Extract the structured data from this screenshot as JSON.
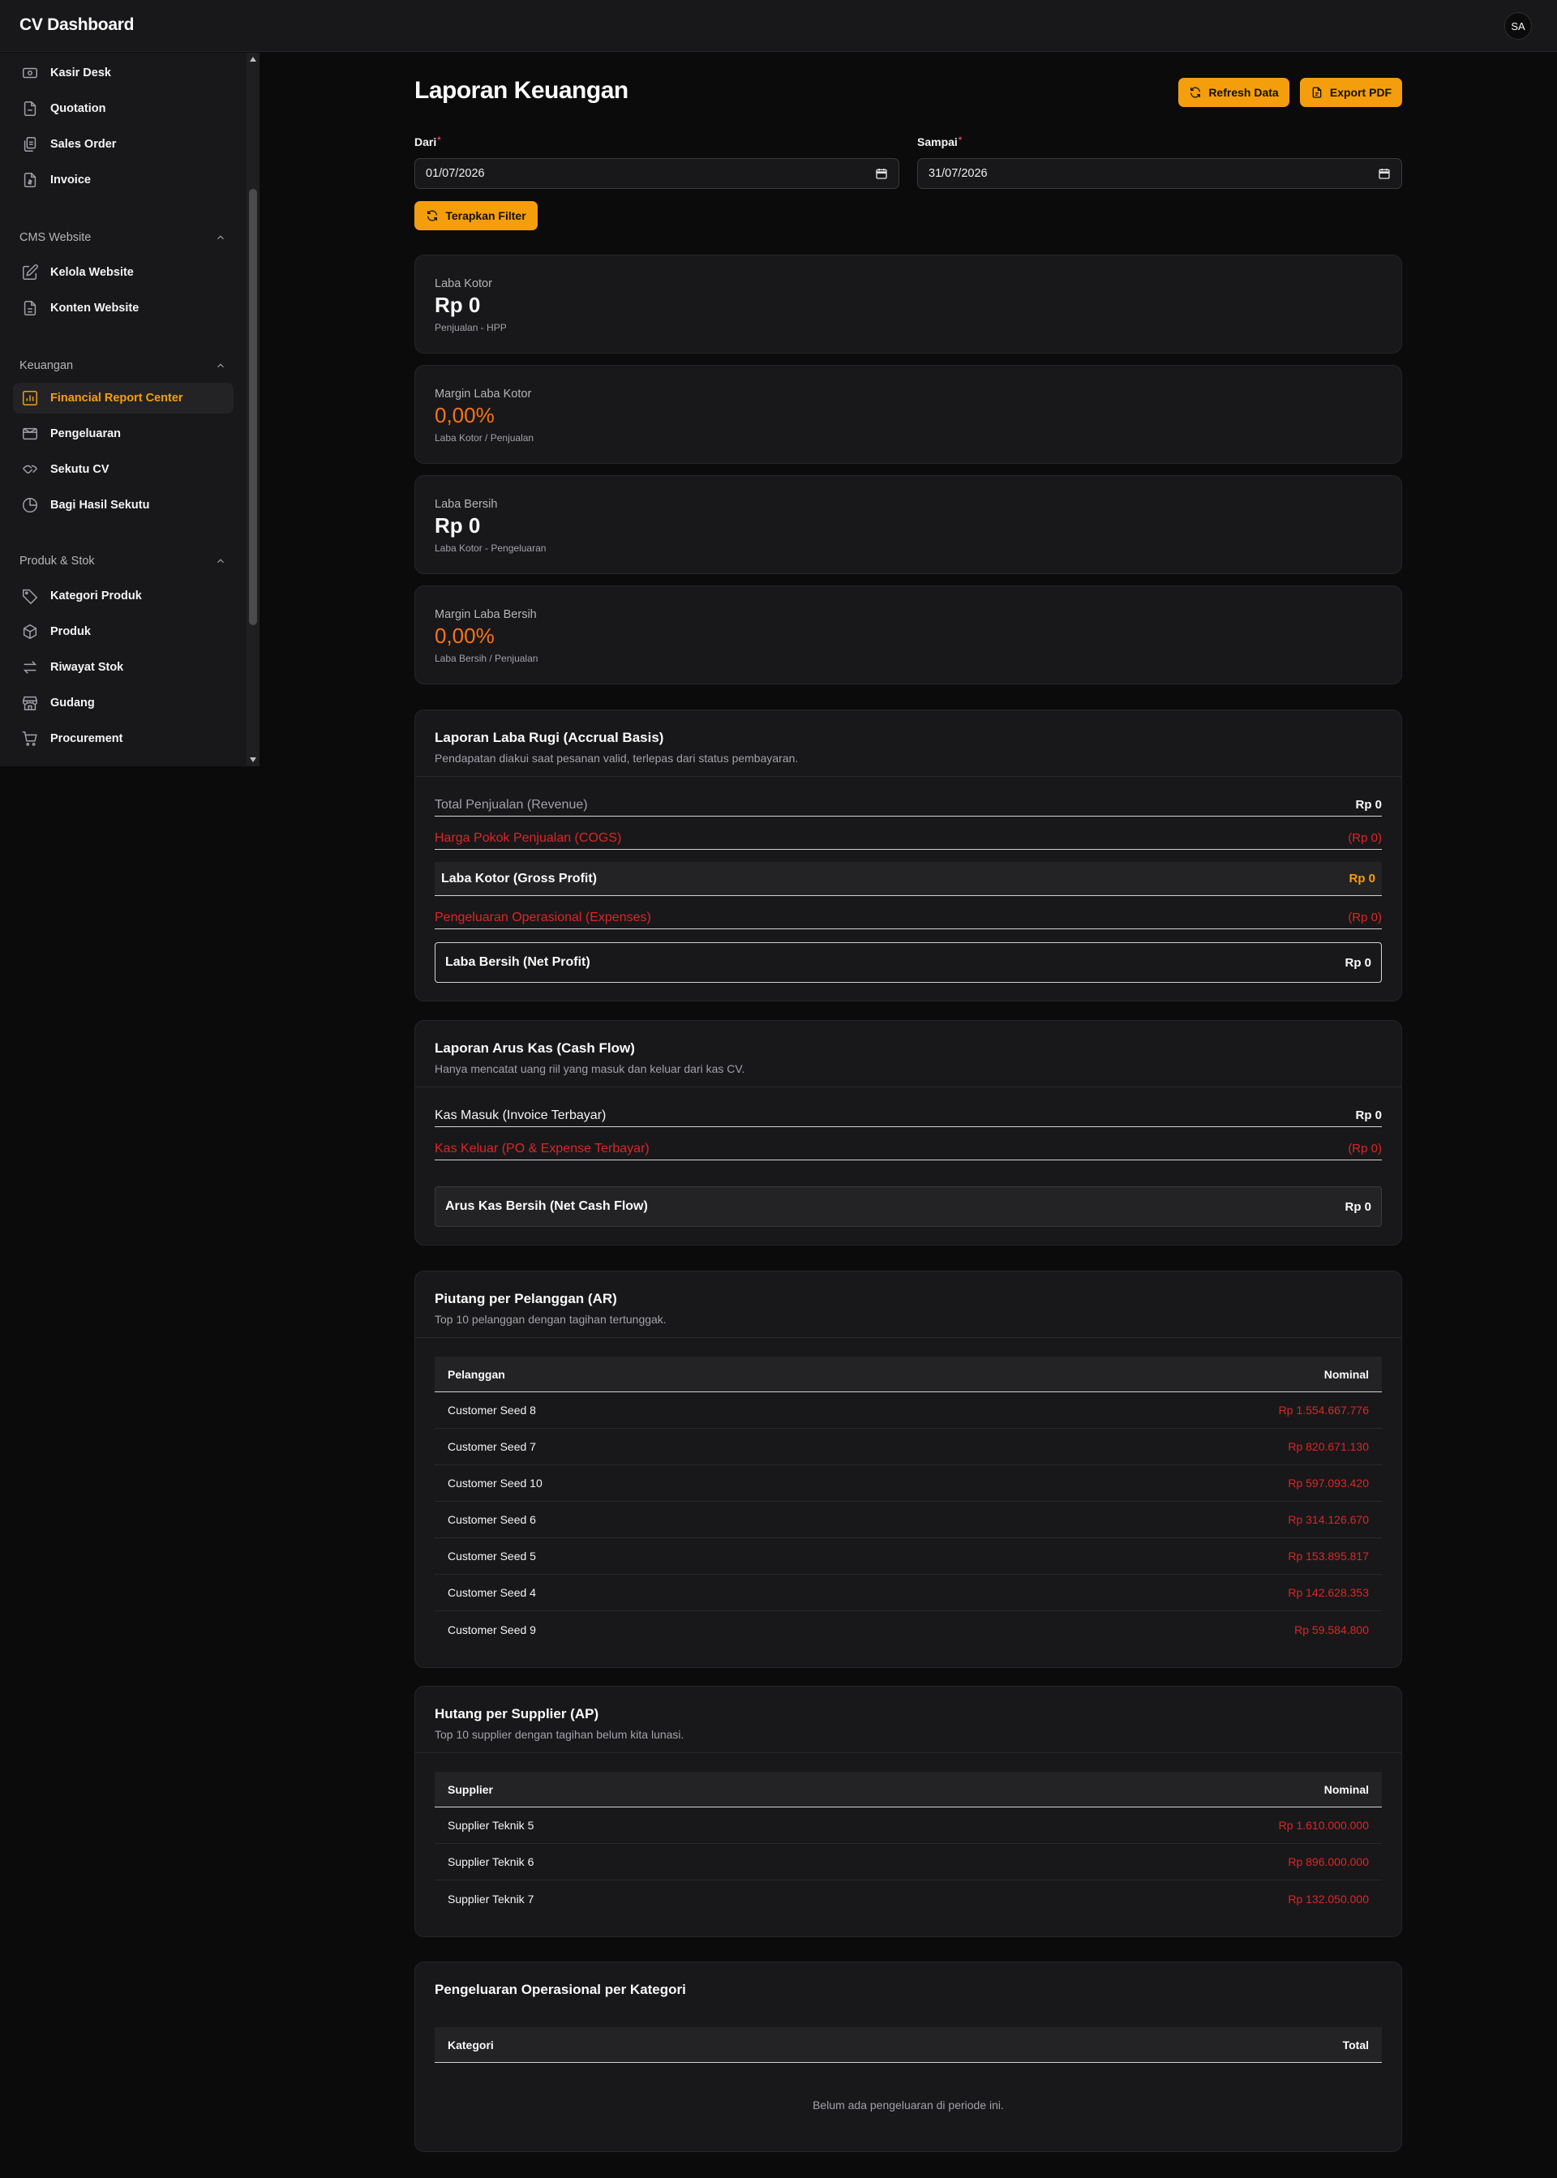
{
  "app": {
    "title": "CV Dashboard",
    "avatar": "SA"
  },
  "sidebar": {
    "items_top": [
      {
        "label": "Kasir Desk",
        "icon": "cash-register-icon"
      },
      {
        "label": "Quotation",
        "icon": "document-icon"
      },
      {
        "label": "Sales Order",
        "icon": "clipboard-icon"
      },
      {
        "label": "Invoice",
        "icon": "invoice-icon"
      }
    ],
    "groups": [
      {
        "label": "CMS Website",
        "items": [
          {
            "label": "Kelola Website",
            "icon": "edit-icon"
          },
          {
            "label": "Konten Website",
            "icon": "file-text-icon"
          }
        ]
      },
      {
        "label": "Keuangan",
        "items": [
          {
            "label": "Financial Report Center",
            "icon": "bar-chart-icon",
            "active": true
          },
          {
            "label": "Pengeluaran",
            "icon": "wallet-icon"
          },
          {
            "label": "Sekutu CV",
            "icon": "users-icon"
          },
          {
            "label": "Bagi Hasil Sekutu",
            "icon": "pie-chart-icon"
          }
        ]
      },
      {
        "label": "Produk & Stok",
        "items": [
          {
            "label": "Kategori Produk",
            "icon": "tag-icon"
          },
          {
            "label": "Produk",
            "icon": "package-icon"
          },
          {
            "label": "Riwayat Stok",
            "icon": "arrows-swap-icon"
          },
          {
            "label": "Gudang",
            "icon": "warehouse-icon"
          },
          {
            "label": "Procurement",
            "icon": "cart-icon"
          }
        ]
      }
    ]
  },
  "page": {
    "title": "Laporan Keuangan",
    "refresh_label": "Refresh Data",
    "export_label": "Export PDF",
    "filter": {
      "from_label": "Dari",
      "from_value": "01/07/2026",
      "to_label": "Sampai",
      "to_value": "31/07/2026",
      "apply_label": "Terapkan Filter",
      "required_mark": "*"
    }
  },
  "kpis": [
    {
      "label": "Laba Kotor",
      "value": "Rp 0",
      "sub": "Penjualan - HPP",
      "accent": false
    },
    {
      "label": "Margin Laba Kotor",
      "value": "0,00%",
      "sub": "Laba Kotor / Penjualan",
      "accent": true
    },
    {
      "label": "Laba Bersih",
      "value": "Rp 0",
      "sub": "Laba Kotor - Pengeluaran",
      "accent": false
    },
    {
      "label": "Margin Laba Bersih",
      "value": "0,00%",
      "sub": "Laba Bersih / Penjualan",
      "accent": true
    }
  ],
  "profit_loss": {
    "title": "Laporan Laba Rugi (Accrual Basis)",
    "subtitle": "Pendapatan diakui saat pesanan valid, terlepas dari status pembayaran.",
    "revenue_label": "Total Penjualan (Revenue)",
    "revenue_value": "Rp 0",
    "cogs_label": "Harga Pokok Penjualan (COGS)",
    "cogs_value": "(Rp 0)",
    "gross_label": "Laba Kotor (Gross Profit)",
    "gross_value": "Rp 0",
    "expenses_label": "Pengeluaran Operasional (Expenses)",
    "expenses_value": "(Rp 0)",
    "net_label": "Laba Bersih (Net Profit)",
    "net_value": "Rp 0"
  },
  "cash_flow": {
    "title": "Laporan Arus Kas (Cash Flow)",
    "subtitle": "Hanya mencatat uang riil yang masuk dan keluar dari kas CV.",
    "in_label": "Kas Masuk (Invoice Terbayar)",
    "in_value": "Rp 0",
    "out_label": "Kas Keluar (PO & Expense Terbayar)",
    "out_value": "(Rp 0)",
    "net_label": "Arus Kas Bersih (Net Cash Flow)",
    "net_value": "Rp 0"
  },
  "ar": {
    "title": "Piutang per Pelanggan (AR)",
    "subtitle": "Top 10 pelanggan dengan tagihan tertunggak.",
    "col_name": "Pelanggan",
    "col_amount": "Nominal",
    "rows": [
      {
        "name": "Customer Seed 8",
        "amount": "Rp 1.554.667.776"
      },
      {
        "name": "Customer Seed 7",
        "amount": "Rp 820.671.130"
      },
      {
        "name": "Customer Seed 10",
        "amount": "Rp 597.093.420"
      },
      {
        "name": "Customer Seed 6",
        "amount": "Rp 314.126.670"
      },
      {
        "name": "Customer Seed 5",
        "amount": "Rp 153.895.817"
      },
      {
        "name": "Customer Seed 4",
        "amount": "Rp 142.628.353"
      },
      {
        "name": "Customer Seed 9",
        "amount": "Rp 59.584.800"
      }
    ]
  },
  "ap": {
    "title": "Hutang per Supplier (AP)",
    "subtitle": "Top 10 supplier dengan tagihan belum kita lunasi.",
    "col_name": "Supplier",
    "col_amount": "Nominal",
    "rows": [
      {
        "name": "Supplier Teknik 5",
        "amount": "Rp 1.610.000.000"
      },
      {
        "name": "Supplier Teknik 6",
        "amount": "Rp 896.000.000"
      },
      {
        "name": "Supplier Teknik 7",
        "amount": "Rp 132.050.000"
      }
    ]
  },
  "expense_by_category": {
    "title": "Pengeluaran Operasional per Kategori",
    "col_name": "Kategori",
    "col_amount": "Total",
    "empty_message": "Belum ada pengeluaran di periode ini."
  },
  "colors": {
    "accent": "#f59e0b",
    "negative": "#dc2626",
    "kpi_orange": "#f97316",
    "background": "#0b0b0c",
    "surface": "#18181a"
  }
}
